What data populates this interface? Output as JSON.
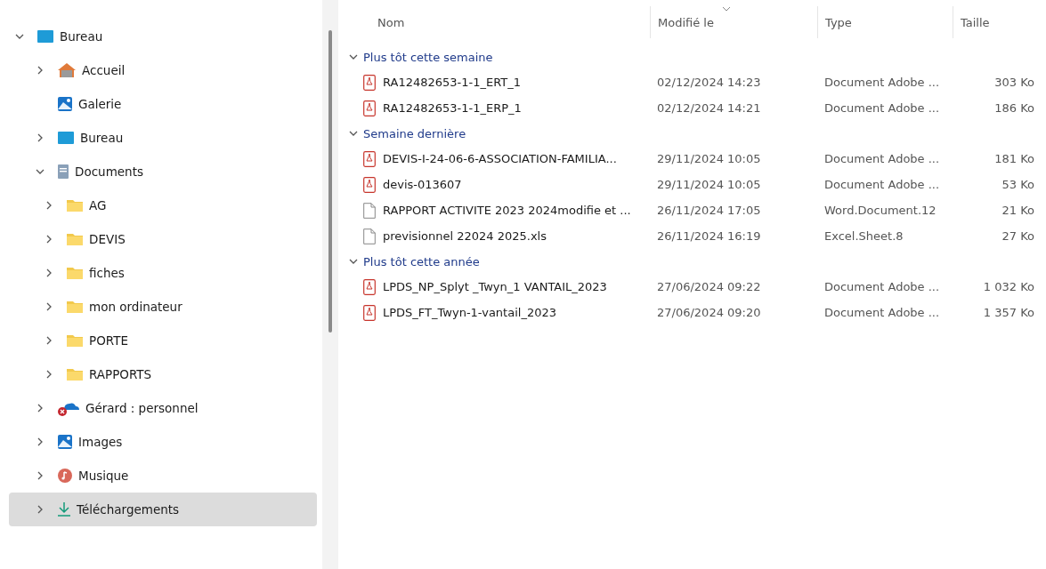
{
  "sidebar": {
    "items": [
      {
        "label": "Bureau",
        "kind": "desktop",
        "expandable": true,
        "expanded": true,
        "selected": false,
        "children": [
          {
            "label": "Accueil",
            "kind": "home",
            "expandable": true,
            "expanded": false,
            "selected": false
          },
          {
            "label": "Galerie",
            "kind": "gallery",
            "expandable": false,
            "expanded": false,
            "selected": false
          },
          {
            "label": "Bureau",
            "kind": "desktop",
            "expandable": true,
            "expanded": false,
            "selected": false
          },
          {
            "label": "Documents",
            "kind": "documents",
            "expandable": true,
            "expanded": true,
            "selected": false,
            "children": [
              {
                "label": "AG",
                "kind": "folder",
                "expandable": true,
                "expanded": false,
                "selected": false
              },
              {
                "label": "DEVIS",
                "kind": "folder",
                "expandable": true,
                "expanded": false,
                "selected": false
              },
              {
                "label": "fiches",
                "kind": "folder",
                "expandable": true,
                "expanded": false,
                "selected": false
              },
              {
                "label": "mon ordinateur",
                "kind": "folder",
                "expandable": true,
                "expanded": false,
                "selected": false
              },
              {
                "label": "PORTE",
                "kind": "folder",
                "expandable": true,
                "expanded": false,
                "selected": false
              },
              {
                "label": "RAPPORTS",
                "kind": "folder",
                "expandable": true,
                "expanded": false,
                "selected": false
              }
            ]
          },
          {
            "label": "Gérard : personnel",
            "kind": "cloud-error",
            "expandable": true,
            "expanded": false,
            "selected": false
          },
          {
            "label": "Images",
            "kind": "gallery",
            "expandable": true,
            "expanded": false,
            "selected": false
          },
          {
            "label": "Musique",
            "kind": "music",
            "expandable": true,
            "expanded": false,
            "selected": false
          },
          {
            "label": "Téléchargements",
            "kind": "download",
            "expandable": true,
            "expanded": false,
            "selected": true
          }
        ]
      }
    ]
  },
  "table": {
    "columns": [
      {
        "label": "Nom",
        "sorted": false
      },
      {
        "label": "Modifié le",
        "sorted": true
      },
      {
        "label": "Type",
        "sorted": false
      },
      {
        "label": "Taille",
        "sorted": false
      }
    ],
    "groups": [
      {
        "label": "Plus tôt cette semaine",
        "expanded": true,
        "rows": [
          {
            "kind": "pdf",
            "name": "RA12482653-1-1_ERT_1",
            "modified": "02/12/2024 14:23",
            "type": "Document Adobe ...",
            "size": "303 Ko"
          },
          {
            "kind": "pdf",
            "name": "RA12482653-1-1_ERP_1",
            "modified": "02/12/2024 14:21",
            "type": "Document Adobe ...",
            "size": "186 Ko"
          }
        ]
      },
      {
        "label": "Semaine dernière",
        "expanded": true,
        "rows": [
          {
            "kind": "pdf",
            "name": "DEVIS-I-24-06-6-ASSOCIATION-FAMILIA...",
            "modified": "29/11/2024 10:05",
            "type": "Document Adobe ...",
            "size": "181 Ko"
          },
          {
            "kind": "pdf",
            "name": "devis-013607",
            "modified": "29/11/2024 10:05",
            "type": "Document Adobe ...",
            "size": "53 Ko"
          },
          {
            "kind": "blank",
            "name": "RAPPORT ACTIVITE 2023 2024modifie et ...",
            "modified": "26/11/2024 17:05",
            "type": "Word.Document.12",
            "size": "21 Ko"
          },
          {
            "kind": "blank",
            "name": "previsionnel 22024 2025.xls",
            "modified": "26/11/2024 16:19",
            "type": "Excel.Sheet.8",
            "size": "27 Ko"
          }
        ]
      },
      {
        "label": "Plus tôt cette année",
        "expanded": true,
        "rows": [
          {
            "kind": "pdf",
            "name": "LPDS_NP_Splyt _Twyn_1 VANTAIL_2023",
            "modified": "27/06/2024 09:22",
            "type": "Document Adobe ...",
            "size": "1 032 Ko"
          },
          {
            "kind": "pdf",
            "name": "LPDS_FT_Twyn-1-vantail_2023",
            "modified": "27/06/2024 09:20",
            "type": "Document Adobe ...",
            "size": "1 357 Ko"
          }
        ]
      }
    ]
  }
}
